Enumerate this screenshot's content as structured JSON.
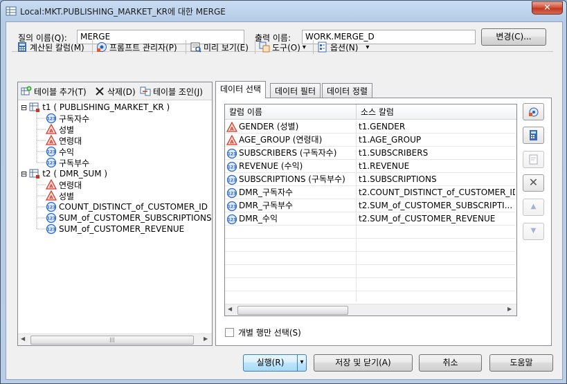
{
  "window": {
    "title": "Local:MKT.PUBLISHING_MARKET_KR에 대한 MERGE",
    "close_glyph": "✕"
  },
  "header": {
    "query_name_label": "질의 이름(Q):",
    "query_name_value": "MERGE",
    "output_name_label": "출력 이름:",
    "output_name_value": "WORK.MERGE_D",
    "change_button": "변경(C)..."
  },
  "toolbar": {
    "computed_columns": "계산된 칼럼(M)",
    "prompt_manager": "프롬프트 관리자(P)",
    "preview": "미리 보기(E)",
    "tools": "도구(O)",
    "options": "옵션(N)",
    "dropdown_glyph": "▾"
  },
  "left_panel": {
    "add_table": "테이블 추가(T)",
    "delete": "삭제(D)",
    "join_tables": "테이블 조인(J)",
    "tree": [
      {
        "type": "table",
        "label": "t1 ( PUBLISHING_MARKET_KR )",
        "expander": "⊟"
      },
      {
        "type": "numeric",
        "label": "구독자수"
      },
      {
        "type": "char",
        "label": "성별"
      },
      {
        "type": "char",
        "label": "연령대"
      },
      {
        "type": "numeric",
        "label": "수익"
      },
      {
        "type": "numeric",
        "label": "구독부수"
      },
      {
        "type": "table",
        "label": "t2 ( DMR_SUM )",
        "expander": "⊟"
      },
      {
        "type": "char",
        "label": "연령대"
      },
      {
        "type": "char",
        "label": "성별"
      },
      {
        "type": "numeric",
        "label": "COUNT_DISTINCT_of_CUSTOMER_ID"
      },
      {
        "type": "numeric",
        "label": "SUM_of_CUSTOMER_SUBSCRIPTIONS"
      },
      {
        "type": "numeric",
        "label": "SUM_of_CUSTOMER_REVENUE"
      }
    ],
    "scroll_left": "◀",
    "scroll_right": "▶",
    "thumb_grip": "|||"
  },
  "tabs": [
    {
      "label": "데이터 선택",
      "active": true
    },
    {
      "label": "데이터 필터",
      "active": false
    },
    {
      "label": "데이터 정렬",
      "active": false
    }
  ],
  "grid": {
    "columns": [
      "칼럼 이름",
      "소스 칼럼"
    ],
    "rows": [
      {
        "type": "char",
        "name": "GENDER (성별)",
        "source": "t1.GENDER"
      },
      {
        "type": "char",
        "name": "AGE_GROUP (연령대)",
        "source": "t1.AGE_GROUP"
      },
      {
        "type": "numeric",
        "name": "SUBSCRIBERS (구독자수)",
        "source": "t1.SUBSCRIBERS"
      },
      {
        "type": "numeric",
        "name": "REVENUE (수익)",
        "source": "t1.REVENUE"
      },
      {
        "type": "numeric",
        "name": "SUBSCRIPTIONS (구독부수)",
        "source": "t1.SUBSCRIPTIONS"
      },
      {
        "type": "numeric",
        "name": "DMR_구독자수",
        "source": "t2.COUNT_DISTINCT_of_CUSTOMER_ID"
      },
      {
        "type": "numeric",
        "name": "DMR_구독부수",
        "source": "t2.SUM_of_CUSTOMER_SUBSCRIPTI..."
      },
      {
        "type": "numeric",
        "name": "DMR_수익",
        "source": "t2.SUM_of_CUSTOMER_REVENUE"
      }
    ],
    "scroll_left": "◀",
    "scroll_right": "▶"
  },
  "side_buttons": {
    "delete_glyph": "✕",
    "up_glyph": "▲",
    "down_glyph": "▼"
  },
  "distinct_rows_label": "개별 행만 선택(S)",
  "distinct_rows_checked": false,
  "footer": {
    "run": "실행(R)",
    "run_dropdown": "▾",
    "save_close": "저장 및 닫기(A)",
    "cancel": "취소",
    "help": "도움말"
  },
  "colors": {
    "char_icon": "#d23b2b",
    "numeric_icon": "#2b67c4"
  }
}
